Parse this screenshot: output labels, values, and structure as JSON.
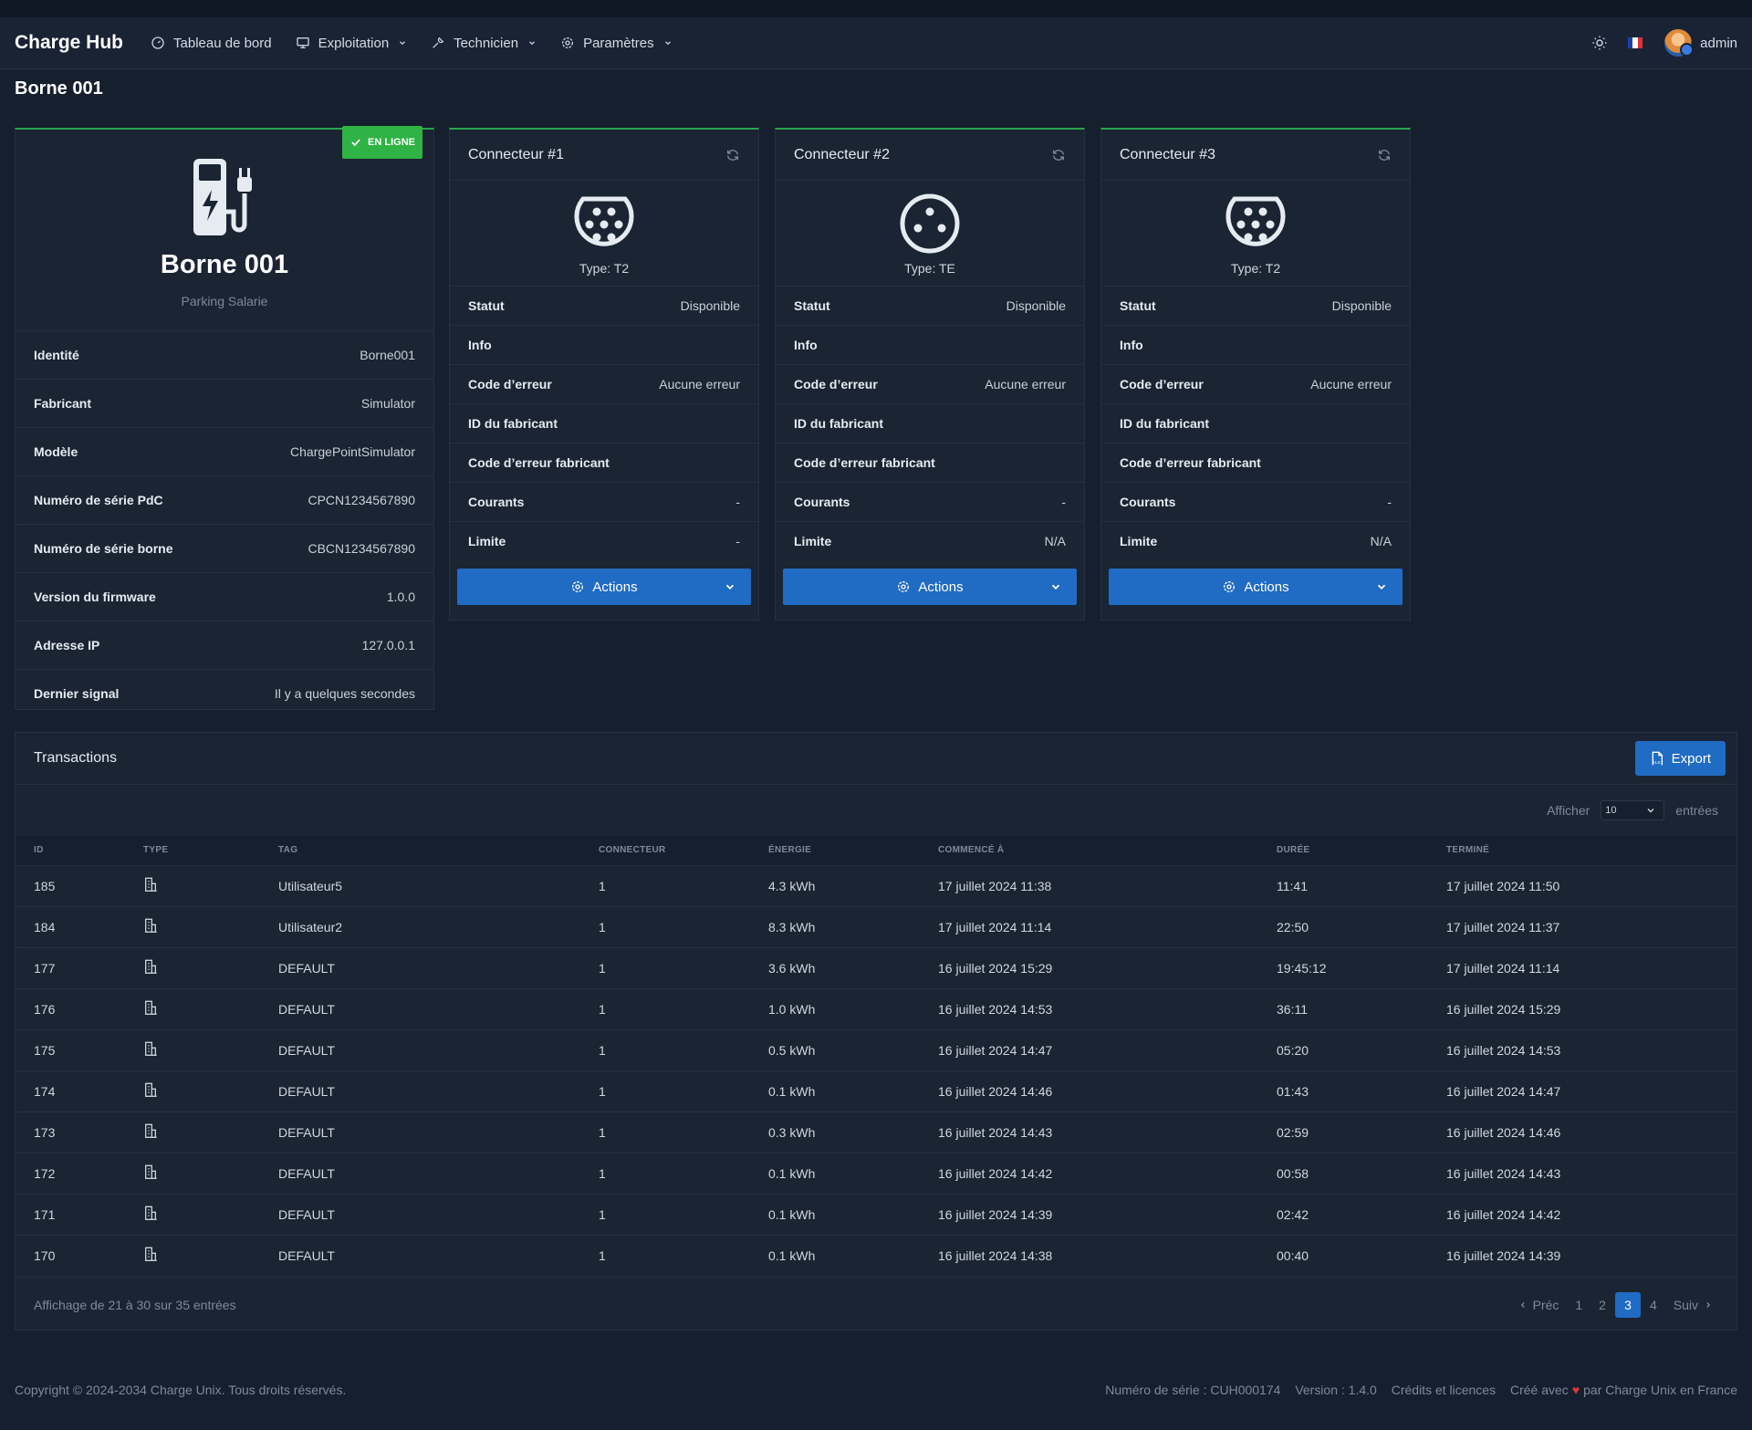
{
  "app": {
    "brand": "Charge Hub"
  },
  "nav": {
    "items": [
      {
        "label": "Tableau de bord"
      },
      {
        "label": "Exploitation"
      },
      {
        "label": "Technicien"
      },
      {
        "label": "Paramètres"
      }
    ],
    "user": "admin"
  },
  "page": {
    "title": "Borne 001"
  },
  "station": {
    "status_badge": "EN LIGNE",
    "name": "Borne 001",
    "location": "Parking Salarie",
    "rows": [
      {
        "key": "Identité",
        "value": "Borne001"
      },
      {
        "key": "Fabricant",
        "value": "Simulator"
      },
      {
        "key": "Modèle",
        "value": "ChargePointSimulator"
      },
      {
        "key": "Numéro de série PdC",
        "value": "CPCN1234567890"
      },
      {
        "key": "Numéro de série borne",
        "value": "CBCN1234567890"
      },
      {
        "key": "Version du firmware",
        "value": "1.0.0"
      },
      {
        "key": "Adresse IP",
        "value": "127.0.0.1"
      },
      {
        "key": "Dernier signal",
        "value": "Il y a quelques secondes"
      }
    ]
  },
  "connectors": [
    {
      "title": "Connecteur #1",
      "type": "Type: T2",
      "actions": "Actions",
      "rows": [
        {
          "key": "Statut",
          "value": "Disponible"
        },
        {
          "key": "Info",
          "value": ""
        },
        {
          "key": "Code d’erreur",
          "value": "Aucune erreur"
        },
        {
          "key": "ID du fabricant",
          "value": ""
        },
        {
          "key": "Code d’erreur fabricant",
          "value": ""
        },
        {
          "key": "Courants",
          "value": "-"
        },
        {
          "key": "Limite",
          "value": "-"
        }
      ]
    },
    {
      "title": "Connecteur #2",
      "type": "Type: TE",
      "actions": "Actions",
      "rows": [
        {
          "key": "Statut",
          "value": "Disponible"
        },
        {
          "key": "Info",
          "value": ""
        },
        {
          "key": "Code d’erreur",
          "value": "Aucune erreur"
        },
        {
          "key": "ID du fabricant",
          "value": ""
        },
        {
          "key": "Code d’erreur fabricant",
          "value": ""
        },
        {
          "key": "Courants",
          "value": "-"
        },
        {
          "key": "Limite",
          "value": "N/A"
        }
      ]
    },
    {
      "title": "Connecteur #3",
      "type": "Type: T2",
      "actions": "Actions",
      "rows": [
        {
          "key": "Statut",
          "value": "Disponible"
        },
        {
          "key": "Info",
          "value": ""
        },
        {
          "key": "Code d’erreur",
          "value": "Aucune erreur"
        },
        {
          "key": "ID du fabricant",
          "value": ""
        },
        {
          "key": "Code d’erreur fabricant",
          "value": ""
        },
        {
          "key": "Courants",
          "value": "-"
        },
        {
          "key": "Limite",
          "value": "N/A"
        }
      ]
    }
  ],
  "transactions": {
    "title": "Transactions",
    "export_label": "Export",
    "show_label": "Afficher",
    "show_value": "10",
    "entries_label": "entrées",
    "columns": [
      "ID",
      "Type",
      "Tag",
      "Connecteur",
      "Énergie",
      "Commencé à",
      "Durée",
      "Terminé"
    ],
    "rows": [
      [
        "185",
        "",
        "Utilisateur5",
        "1",
        "4.3 kWh",
        "17 juillet 2024 11:38",
        "11:41",
        "17 juillet 2024 11:50"
      ],
      [
        "184",
        "",
        "Utilisateur2",
        "1",
        "8.3 kWh",
        "17 juillet 2024 11:14",
        "22:50",
        "17 juillet 2024 11:37"
      ],
      [
        "177",
        "",
        "DEFAULT",
        "1",
        "3.6 kWh",
        "16 juillet 2024 15:29",
        "19:45:12",
        "17 juillet 2024 11:14"
      ],
      [
        "176",
        "",
        "DEFAULT",
        "1",
        "1.0 kWh",
        "16 juillet 2024 14:53",
        "36:11",
        "16 juillet 2024 15:29"
      ],
      [
        "175",
        "",
        "DEFAULT",
        "1",
        "0.5 kWh",
        "16 juillet 2024 14:47",
        "05:20",
        "16 juillet 2024 14:53"
      ],
      [
        "174",
        "",
        "DEFAULT",
        "1",
        "0.1 kWh",
        "16 juillet 2024 14:46",
        "01:43",
        "16 juillet 2024 14:47"
      ],
      [
        "173",
        "",
        "DEFAULT",
        "1",
        "0.3 kWh",
        "16 juillet 2024 14:43",
        "02:59",
        "16 juillet 2024 14:46"
      ],
      [
        "172",
        "",
        "DEFAULT",
        "1",
        "0.1 kWh",
        "16 juillet 2024 14:42",
        "00:58",
        "16 juillet 2024 14:43"
      ],
      [
        "171",
        "",
        "DEFAULT",
        "1",
        "0.1 kWh",
        "16 juillet 2024 14:39",
        "02:42",
        "16 juillet 2024 14:42"
      ],
      [
        "170",
        "",
        "DEFAULT",
        "1",
        "0.1 kWh",
        "16 juillet 2024 14:38",
        "00:40",
        "16 juillet 2024 14:39"
      ]
    ],
    "footer_info": "Affichage de 21 à 30 sur 35 entrées",
    "pager": {
      "prev": "Préc",
      "pages": [
        "1",
        "2",
        "3",
        "4"
      ],
      "current": "3",
      "next": "Suiv"
    }
  },
  "footer": {
    "copyright": "Copyright © 2024-2034 Charge Unix. Tous droits réservés.",
    "serial": "Numéro de série : CUH000174",
    "version": "Version : 1.4.0",
    "credits": "Crédits et licences",
    "made_with": "Créé avec",
    "made_by": "par Charge Unix en France"
  },
  "colors": {
    "accent": "#206bc4",
    "online": "#2fb344",
    "background": "#151f2d",
    "card": "#1a2433"
  }
}
